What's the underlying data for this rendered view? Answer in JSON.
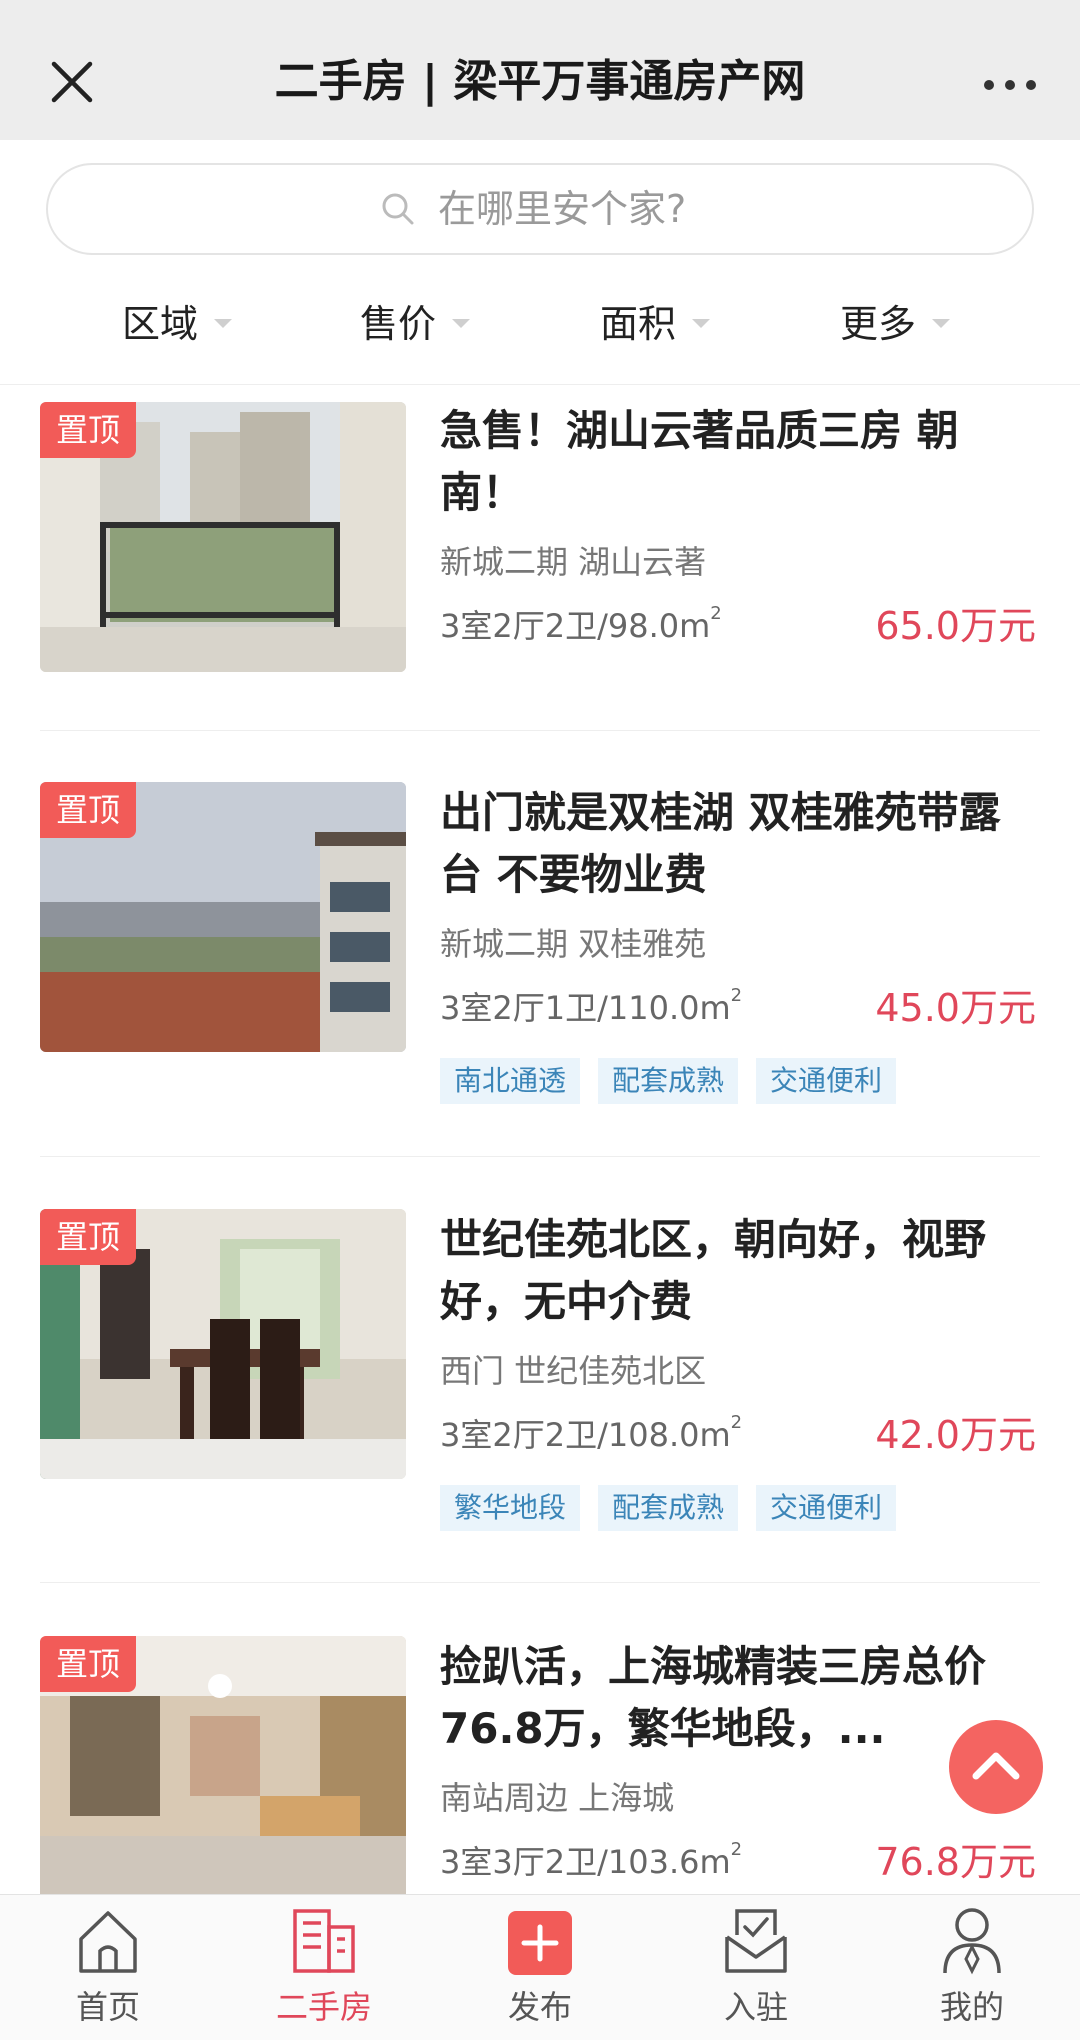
{
  "header": {
    "title": "二手房 | 梁平万事通房产网",
    "close_icon": "close-icon",
    "more_icon": "more-dots-icon"
  },
  "search": {
    "placeholder": "在哪里安个家?",
    "icon": "search-icon"
  },
  "filters": [
    {
      "label": "区域"
    },
    {
      "label": "售价"
    },
    {
      "label": "面积"
    },
    {
      "label": "更多"
    }
  ],
  "listings": [
    {
      "badge": "置顶",
      "title": "急售！湖山云著品质三房 朝南！",
      "location": "新城二期 湖山云著",
      "spec": "3室2厅2卫/98.0m",
      "spec_unit_sup": "2",
      "price": "65.0万元",
      "tags": []
    },
    {
      "badge": "置顶",
      "title": "出门就是双桂湖 双桂雅苑带露台 不要物业费",
      "location": "新城二期 双桂雅苑",
      "spec": "3室2厅1卫/110.0m",
      "spec_unit_sup": "2",
      "price": "45.0万元",
      "tags": [
        "南北通透",
        "配套成熟",
        "交通便利"
      ]
    },
    {
      "badge": "置顶",
      "title": "世纪佳苑北区，朝向好，视野好，无中介费",
      "location": "西门 世纪佳苑北区",
      "spec": "3室2厅2卫/108.0m",
      "spec_unit_sup": "2",
      "price": "42.0万元",
      "tags": [
        "繁华地段",
        "配套成熟",
        "交通便利"
      ]
    },
    {
      "badge": "置顶",
      "title": "捡趴活，上海城精装三房总价76.8万，繁华地段，...",
      "location": "南站周边 上海城",
      "spec": "3室3厅2卫/103.6m",
      "spec_unit_sup": "2",
      "price": "76.8万元",
      "tags": []
    }
  ],
  "scroll_top_icon": "chevron-up-icon",
  "nav": [
    {
      "label": "首页",
      "icon": "home-icon",
      "active": false
    },
    {
      "label": "二手房",
      "icon": "building-icon",
      "active": true
    },
    {
      "label": "发布",
      "icon": "plus-icon",
      "active": false
    },
    {
      "label": "入驻",
      "icon": "inbox-check-icon",
      "active": false
    },
    {
      "label": "我的",
      "icon": "user-icon",
      "active": false
    }
  ],
  "colors": {
    "accent": "#e0475a",
    "badge": "#f25b58",
    "tag_bg": "#eaf4fb",
    "tag_text": "#3b85b8"
  }
}
